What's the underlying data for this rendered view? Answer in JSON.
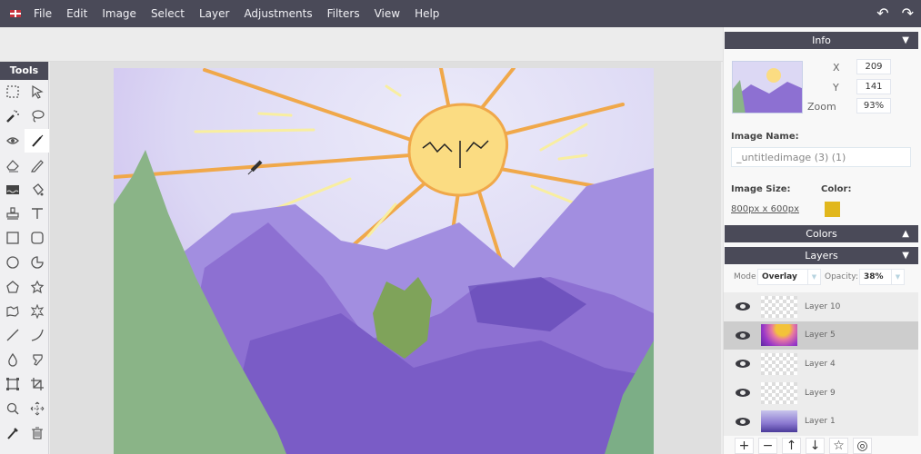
{
  "menubar": {
    "language_icon": "uk-flag-icon",
    "items": [
      "File",
      "Edit",
      "Image",
      "Select",
      "Layer",
      "Adjustments",
      "Filters",
      "View",
      "Help"
    ],
    "undo_icon": "↶",
    "redo_icon": "↷"
  },
  "tools": {
    "title": "Tools",
    "items": [
      {
        "name": "rect-select",
        "active": false
      },
      {
        "name": "pointer",
        "active": false
      },
      {
        "name": "magic-wand",
        "active": false
      },
      {
        "name": "lasso",
        "active": false
      },
      {
        "name": "fill-eye",
        "active": false
      },
      {
        "name": "brush",
        "active": true
      },
      {
        "name": "eraser",
        "active": false
      },
      {
        "name": "pencil",
        "active": false
      },
      {
        "name": "gradient",
        "active": false
      },
      {
        "name": "paint-bucket",
        "active": false
      },
      {
        "name": "stamp",
        "active": false
      },
      {
        "name": "text",
        "active": false
      },
      {
        "name": "rectangle",
        "active": false
      },
      {
        "name": "rounded-rectangle",
        "active": false
      },
      {
        "name": "circle",
        "active": false
      },
      {
        "name": "pie",
        "active": false
      },
      {
        "name": "pentagon",
        "active": false
      },
      {
        "name": "star",
        "active": false
      },
      {
        "name": "freeform-shape",
        "active": false
      },
      {
        "name": "burst",
        "active": false
      },
      {
        "name": "line",
        "active": false
      },
      {
        "name": "curve",
        "active": false
      },
      {
        "name": "blur-drop",
        "active": false
      },
      {
        "name": "smudge",
        "active": false
      },
      {
        "name": "transform",
        "active": false
      },
      {
        "name": "crop",
        "active": false
      },
      {
        "name": "zoom",
        "active": false
      },
      {
        "name": "move",
        "active": false
      },
      {
        "name": "color-picker",
        "active": false
      },
      {
        "name": "trash",
        "active": false
      }
    ]
  },
  "info": {
    "title": "Info",
    "x_label": "X",
    "x_value": "209",
    "y_label": "Y",
    "y_value": "141",
    "zoom_label": "Zoom",
    "zoom_value": "93%",
    "image_name_label": "Image Name:",
    "image_name_value": "_untitledimage (3) (1)",
    "image_size_label": "Image Size:",
    "image_size_value": "800px x 600px",
    "color_label": "Color:",
    "color_value": "#e1b71d"
  },
  "colors_panel": {
    "title": "Colors",
    "arrow": "▲"
  },
  "layers_panel": {
    "title": "Layers",
    "arrow": "▼",
    "mode_label": "Mode",
    "mode_value": "Overlay",
    "opacity_label": "Opacity:",
    "opacity_value": "38%",
    "layers": [
      {
        "name": "Layer 10",
        "active": false
      },
      {
        "name": "Layer 5",
        "active": true
      },
      {
        "name": "Layer 4",
        "active": false
      },
      {
        "name": "Layer 9",
        "active": false
      },
      {
        "name": "Layer 1",
        "active": false
      }
    ],
    "buttons": [
      "+",
      "−",
      "↑",
      "↓",
      "☆",
      "◎"
    ]
  }
}
